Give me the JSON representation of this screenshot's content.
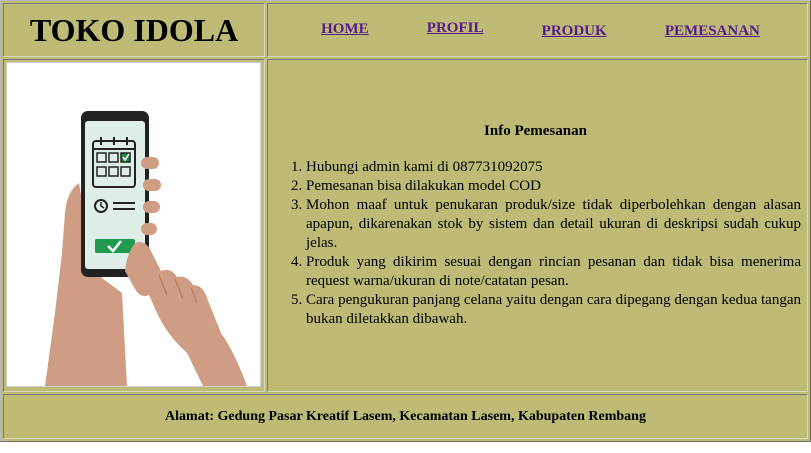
{
  "brand": {
    "title": "TOKO IDOLA"
  },
  "nav": {
    "items": [
      {
        "label": "HOME"
      },
      {
        "label": "PROFIL"
      },
      {
        "label": "PRODUK"
      },
      {
        "label": "PEMESANAN"
      }
    ]
  },
  "illustration": {
    "icon": "phone-checklist-icon"
  },
  "info": {
    "title": "Info Pemesanan",
    "items": [
      "Hubungi admin kami di 087731092075",
      "Pemesanan bisa dilakukan model COD",
      "Mohon maaf untuk penukaran produk/size tidak diperbolehkan dengan alasan apapun, dikarenakan stok by sistem dan detail ukuran di deskripsi sudah cukup jelas.",
      "Produk yang dikirim sesuai dengan rincian pesanan dan tidak bisa menerima request warna/ukuran di note/catatan pesan.",
      "Cara pengukuran panjang celana yaitu dengan cara dipegang dengan kedua tangan bukan diletakkan dibawah."
    ]
  },
  "footer": {
    "address": "Alamat: Gedung Pasar Kreatif Lasem, Kecamatan Lasem, Kabupaten Rembang"
  },
  "colors": {
    "background": "#bdbb75",
    "link": "#551a8b"
  }
}
